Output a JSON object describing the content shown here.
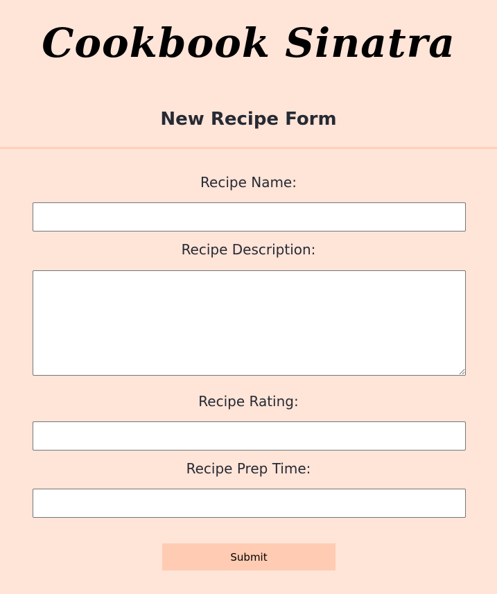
{
  "header": {
    "site_title": "Cookbook Sinatra",
    "form_heading": "New Recipe Form"
  },
  "form": {
    "name_label": "Recipe Name:",
    "name_value": "",
    "description_label": "Recipe Description:",
    "description_value": "",
    "rating_label": "Recipe Rating:",
    "rating_value": "",
    "prep_time_label": "Recipe Prep Time:",
    "prep_time_value": "",
    "submit_label": "Submit"
  },
  "colors": {
    "background": "#ffe4d8",
    "divider": "#ffd0b8",
    "button": "#ffcbb2"
  }
}
